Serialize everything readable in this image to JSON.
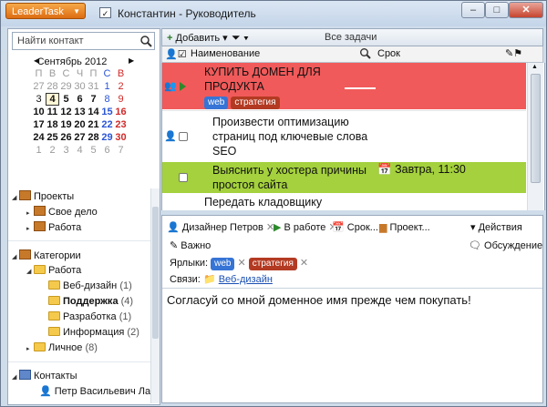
{
  "app": {
    "menu_label": "LeaderTask",
    "window_title": "Константин - Руководитель"
  },
  "window_controls": {
    "minimize": "–",
    "maximize": "□",
    "close": "✕"
  },
  "sidebar": {
    "search_placeholder": "Найти контакт",
    "calendar": {
      "month": "Сентябрь 2012",
      "prev": "◀",
      "next": "▶",
      "weekdays": [
        "П",
        "В",
        "С",
        "Ч",
        "П",
        "С",
        "В"
      ],
      "weeks": [
        [
          "27",
          "28",
          "29",
          "30",
          "31",
          "1",
          "2"
        ],
        [
          "3",
          "4",
          "5",
          "6",
          "7",
          "8",
          "9"
        ],
        [
          "10",
          "11",
          "12",
          "13",
          "14",
          "15",
          "16"
        ],
        [
          "17",
          "18",
          "19",
          "20",
          "21",
          "22",
          "23"
        ],
        [
          "24",
          "25",
          "26",
          "27",
          "28",
          "29",
          "30"
        ],
        [
          "1",
          "2",
          "3",
          "4",
          "5",
          "6",
          "7"
        ]
      ],
      "today": "4"
    },
    "projects": {
      "label": "Проекты",
      "items": [
        "Свое дело",
        "Работа"
      ]
    },
    "categories": {
      "label": "Категории",
      "work": "Работа",
      "work_items": [
        {
          "label": "Веб-дизайн",
          "count": "(1)"
        },
        {
          "label": "Поддержка",
          "count": "(4)"
        },
        {
          "label": "Разработка",
          "count": "(1)"
        },
        {
          "label": "Информация",
          "count": "(2)"
        }
      ],
      "personal": {
        "label": "Личное",
        "count": "(8)"
      }
    },
    "contacts": {
      "label": "Контакты",
      "first": "Петр Васильевич Лаг"
    }
  },
  "toolbar": {
    "add_label": "Добавить",
    "view_title": "Все задачи"
  },
  "columns": {
    "name": "Наименование",
    "due": "Срок"
  },
  "tasks": [
    {
      "title_line1": "КУПИТЬ ДОМЕН ДЛЯ",
      "title_line2": "ПРОДУКТА",
      "tags": [
        "web",
        "стратегия"
      ],
      "color": "#f15a5a"
    },
    {
      "title_line1": "Произвести оптимизацию",
      "title_line2": "страниц под ключевые слова",
      "title_line3": "SEO"
    },
    {
      "title_line1": "Выяснить у хостера причины",
      "title_line2": "простоя сайта",
      "due": "Завтра, 11:30",
      "color": "#a4d13d"
    },
    {
      "title_line1": "Передать кладовщику"
    }
  ],
  "details": {
    "assignee": "Дизайнер Петров",
    "status": "В работе",
    "due_btn": "Срок...",
    "project_btn": "Проект...",
    "actions": "Действия",
    "important": "Важно",
    "discussion": "Обсуждение",
    "tags_label": "Ярлыки:",
    "tags": [
      "web",
      "стратегия"
    ],
    "links_label": "Связи:",
    "link": "Веб-дизайн",
    "note": "Согласуй со мной доменное имя прежде чем покупать!"
  }
}
